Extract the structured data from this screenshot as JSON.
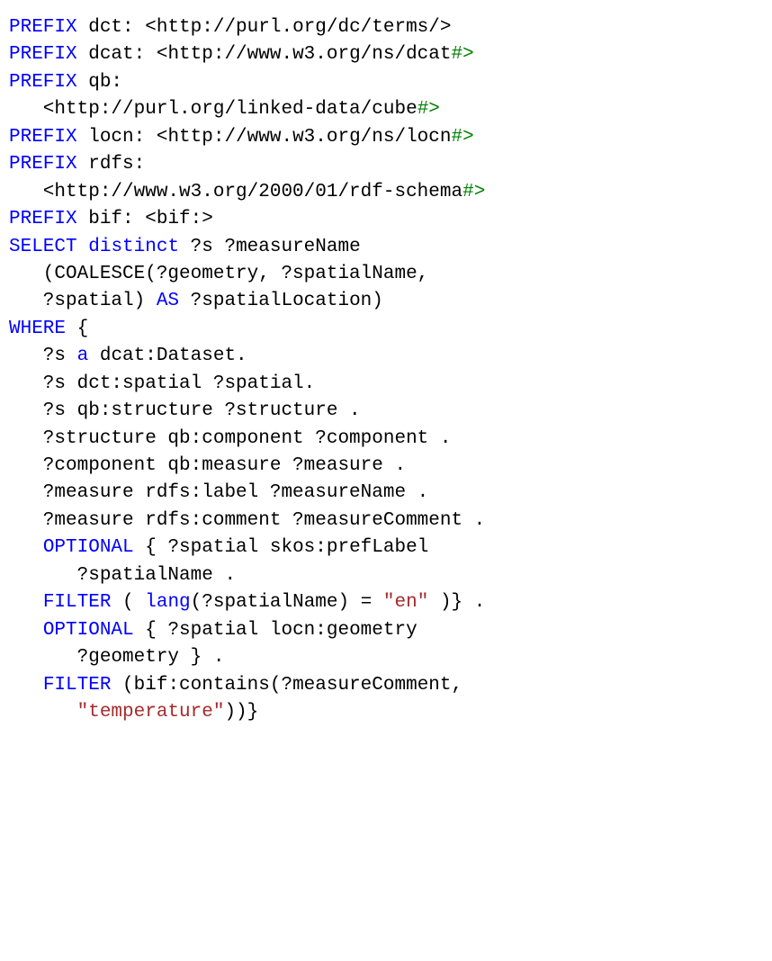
{
  "code": {
    "lines": [
      [
        {
          "t": "PREFIX",
          "c": "kw"
        },
        {
          "t": " dct: <http://purl.org/dc/terms/>",
          "c": "plain"
        }
      ],
      [
        {
          "t": "PREFIX",
          "c": "kw"
        },
        {
          "t": " dcat: <http://www.w3.org/ns/dcat",
          "c": "plain"
        },
        {
          "t": "#>",
          "c": "hash"
        }
      ],
      [
        {
          "t": "PREFIX",
          "c": "kw"
        },
        {
          "t": " qb:",
          "c": "plain"
        }
      ],
      [
        {
          "t": "   <http://purl.org/linked-data/cube",
          "c": "plain"
        },
        {
          "t": "#>",
          "c": "hash"
        }
      ],
      [
        {
          "t": "PREFIX",
          "c": "kw"
        },
        {
          "t": " locn: <http://www.w3.org/ns/locn",
          "c": "plain"
        },
        {
          "t": "#>",
          "c": "hash"
        }
      ],
      [
        {
          "t": "PREFIX",
          "c": "kw"
        },
        {
          "t": " rdfs:",
          "c": "plain"
        }
      ],
      [
        {
          "t": "   <http://www.w3.org/2000/01/rdf-schema",
          "c": "plain"
        },
        {
          "t": "#>",
          "c": "hash"
        }
      ],
      [
        {
          "t": "PREFIX",
          "c": "kw"
        },
        {
          "t": " bif: <bif:>",
          "c": "plain"
        }
      ],
      [
        {
          "t": "SELECT",
          "c": "kw"
        },
        {
          "t": " ",
          "c": "plain"
        },
        {
          "t": "distinct",
          "c": "kw"
        },
        {
          "t": " ?s ?measureName",
          "c": "plain"
        }
      ],
      [
        {
          "t": "   (COALESCE(?geometry, ?spatialName,",
          "c": "plain"
        }
      ],
      [
        {
          "t": "   ?spatial) ",
          "c": "plain"
        },
        {
          "t": "AS",
          "c": "kw"
        },
        {
          "t": " ?spatialLocation)",
          "c": "plain"
        }
      ],
      [
        {
          "t": "WHERE",
          "c": "kw"
        },
        {
          "t": " {",
          "c": "plain"
        }
      ],
      [
        {
          "t": "   ?s ",
          "c": "plain"
        },
        {
          "t": "a",
          "c": "kw"
        },
        {
          "t": " dcat:Dataset.",
          "c": "plain"
        }
      ],
      [
        {
          "t": "   ?s dct:spatial ?spatial.",
          "c": "plain"
        }
      ],
      [
        {
          "t": "   ?s qb:structure ?structure .",
          "c": "plain"
        }
      ],
      [
        {
          "t": "   ?structure qb:component ?component .",
          "c": "plain"
        }
      ],
      [
        {
          "t": "   ?component qb:measure ?measure .",
          "c": "plain"
        }
      ],
      [
        {
          "t": "   ?measure rdfs:label ?measureName .",
          "c": "plain"
        }
      ],
      [
        {
          "t": "   ?measure rdfs:comment ?measureComment .",
          "c": "plain"
        }
      ],
      [
        {
          "t": "   ",
          "c": "plain"
        },
        {
          "t": "OPTIONAL",
          "c": "kw"
        },
        {
          "t": " { ?spatial skos:prefLabel",
          "c": "plain"
        }
      ],
      [
        {
          "t": "      ?spatialName .",
          "c": "plain"
        }
      ],
      [
        {
          "t": "   ",
          "c": "plain"
        },
        {
          "t": "FILTER",
          "c": "kw"
        },
        {
          "t": " ( ",
          "c": "plain"
        },
        {
          "t": "lang",
          "c": "kw"
        },
        {
          "t": "(?spatialName) = ",
          "c": "plain"
        },
        {
          "t": "\"en\"",
          "c": "str"
        },
        {
          "t": " )} .",
          "c": "plain"
        }
      ],
      [
        {
          "t": "   ",
          "c": "plain"
        },
        {
          "t": "OPTIONAL",
          "c": "kw"
        },
        {
          "t": " { ?spatial locn:geometry",
          "c": "plain"
        }
      ],
      [
        {
          "t": "      ?geometry } .",
          "c": "plain"
        }
      ],
      [
        {
          "t": "   ",
          "c": "plain"
        },
        {
          "t": "FILTER",
          "c": "kw"
        },
        {
          "t": " (bif:contains(?measureComment,",
          "c": "plain"
        }
      ],
      [
        {
          "t": "      ",
          "c": "plain"
        },
        {
          "t": "\"temperature\"",
          "c": "str"
        },
        {
          "t": "))}",
          "c": "plain"
        }
      ]
    ]
  }
}
